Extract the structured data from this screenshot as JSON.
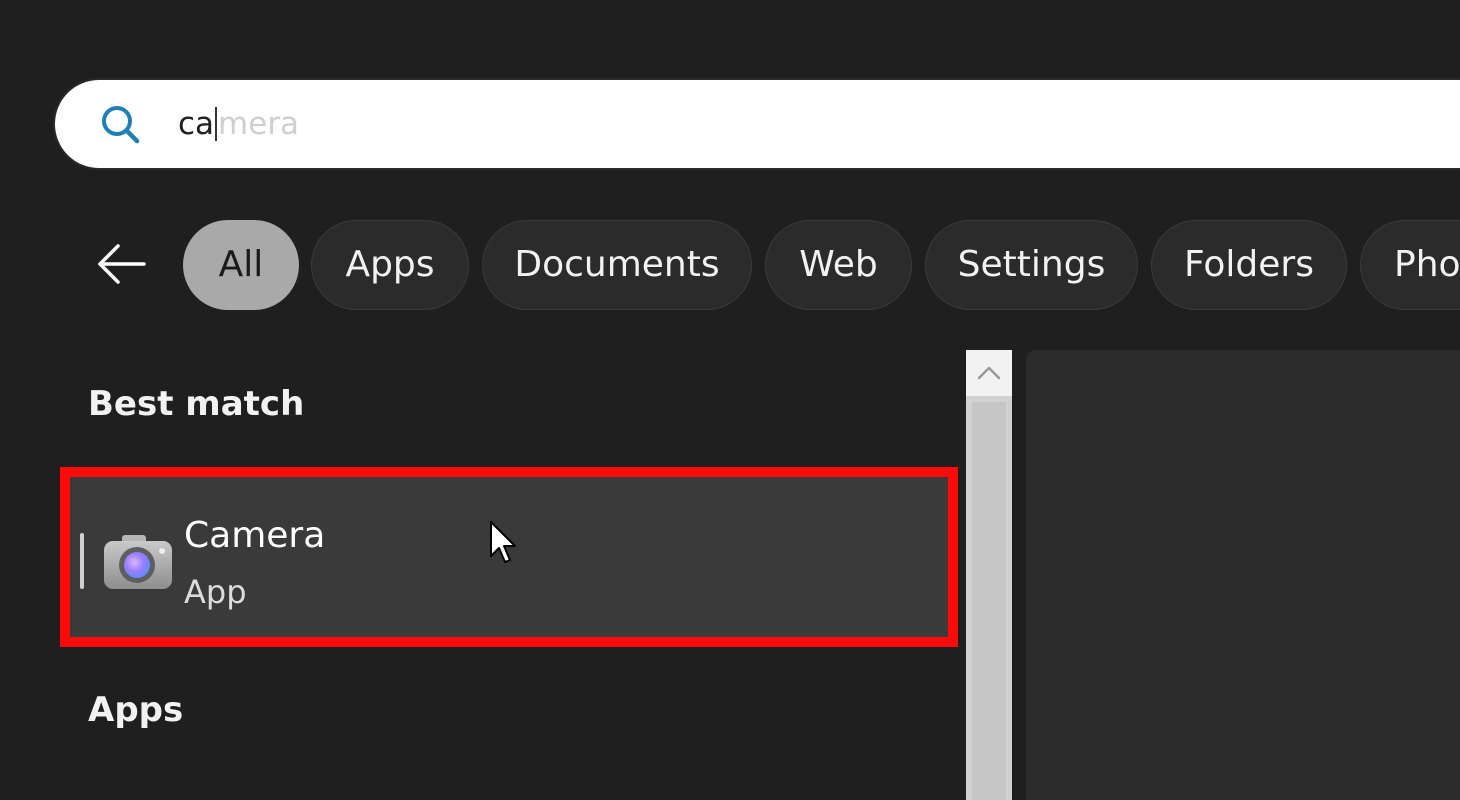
{
  "search": {
    "typed": "ca",
    "ghost_completion": "mera"
  },
  "filters": {
    "chips": [
      {
        "label": "All",
        "active": true
      },
      {
        "label": "Apps",
        "active": false
      },
      {
        "label": "Documents",
        "active": false
      },
      {
        "label": "Web",
        "active": false
      },
      {
        "label": "Settings",
        "active": false
      },
      {
        "label": "Folders",
        "active": false
      },
      {
        "label": "Pho",
        "active": false
      }
    ]
  },
  "results": {
    "best_match_heading": "Best match",
    "best_match": {
      "title": "Camera",
      "subtitle": "App",
      "icon": "camera-icon"
    },
    "apps_heading": "Apps"
  },
  "colors": {
    "highlight_border": "#ff0a0a",
    "active_chip": "#a9a9a9",
    "background": "#1f1f1f"
  }
}
